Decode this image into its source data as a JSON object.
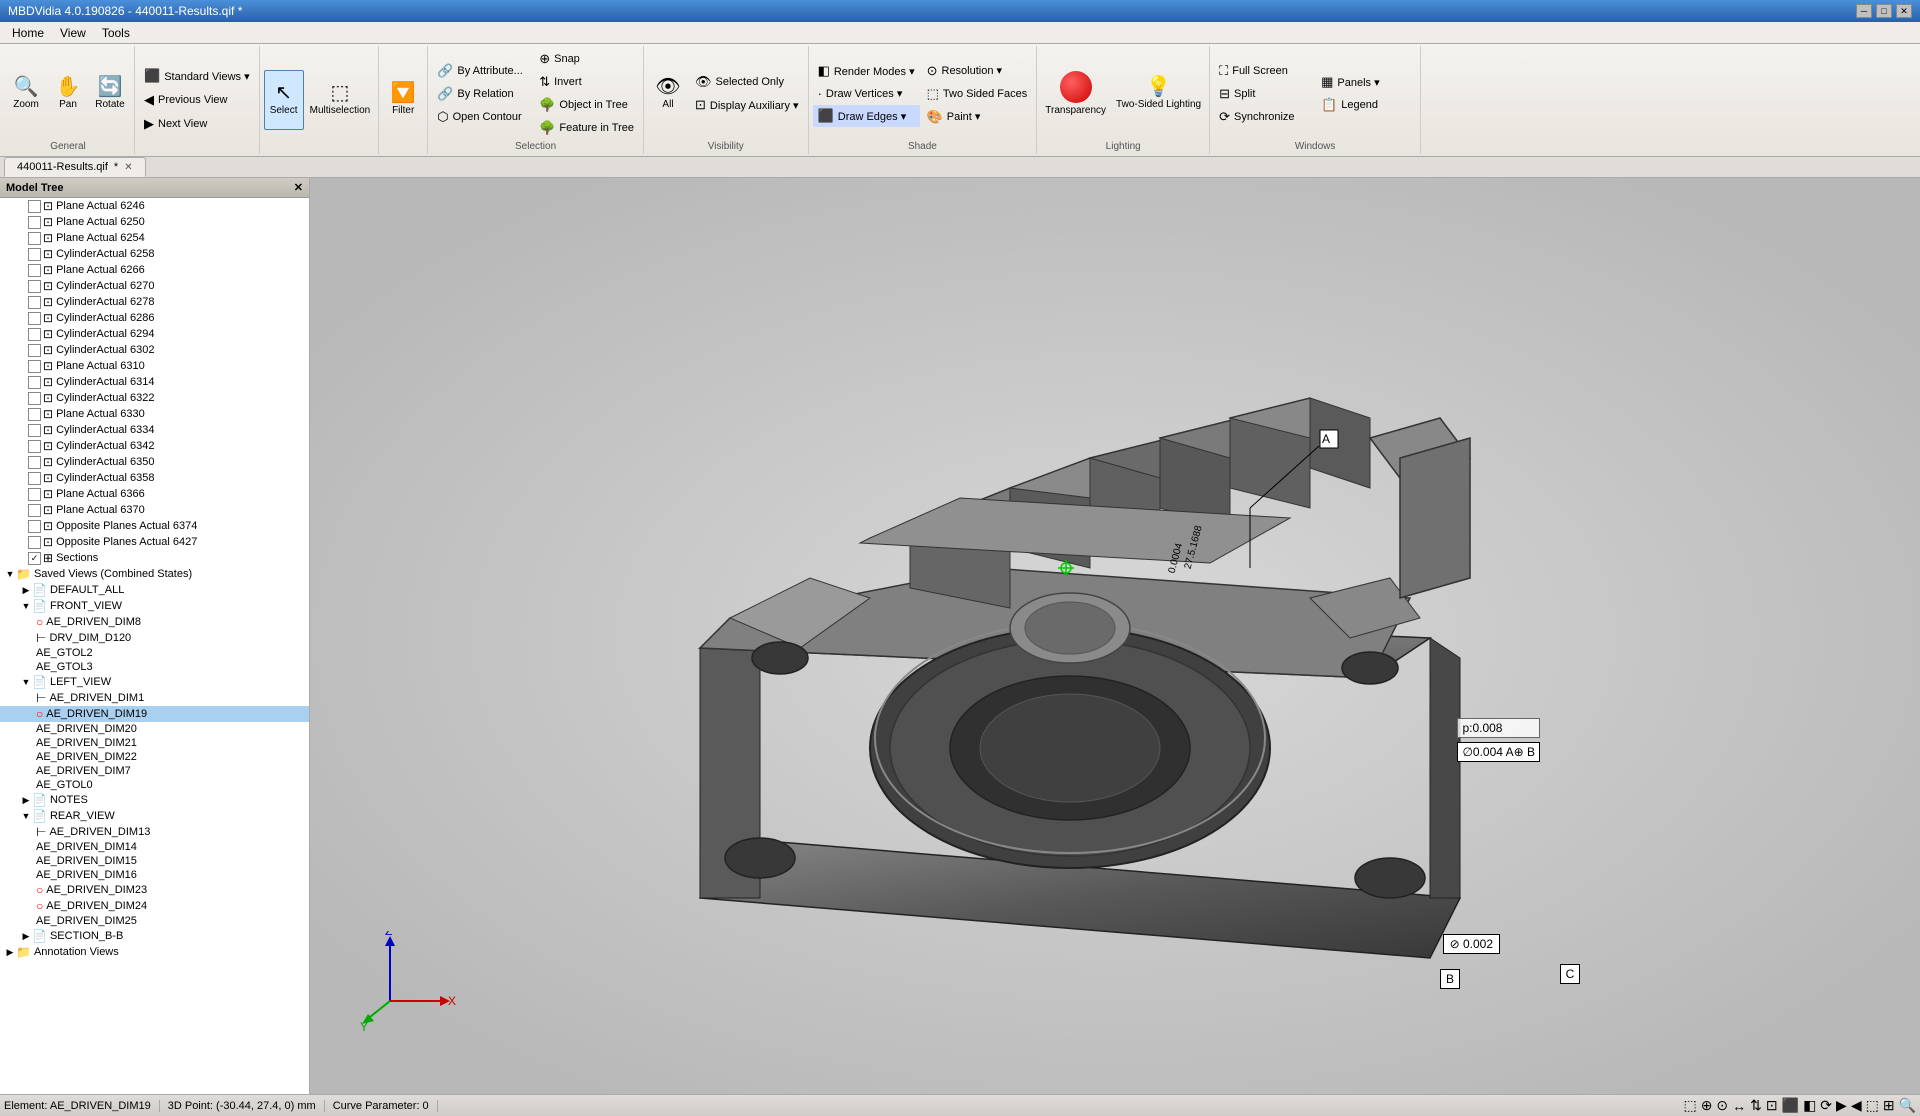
{
  "titleBar": {
    "title": "MBDVidia 4.0.190826 - 440011-Results.qif *",
    "minimize": "─",
    "restore": "□",
    "close": "✕"
  },
  "menuBar": {
    "items": [
      "Home",
      "View",
      "Tools"
    ]
  },
  "toolbar": {
    "general": {
      "label": "General",
      "zoom_label": "Zoom",
      "pan_label": "Pan",
      "rotate_label": "Rotate"
    },
    "standardViews": {
      "label": "Standard Views ▾",
      "previousView": "Previous View",
      "nextView": "Next View"
    },
    "select": {
      "label": "Select"
    },
    "multiselection": "Multiselection",
    "filter": {
      "label": "Filter"
    },
    "selection": {
      "label": "Selection",
      "byAttribute": "By Attribute...",
      "byRelation": "By Relation",
      "snap": "Snap",
      "openContour": "Open Contour",
      "invert": "Invert",
      "objectInTree": "Object in Tree",
      "featureInTree": "Feature in Tree"
    },
    "visibility": {
      "label": "Visibility",
      "all": "All",
      "selectedOnly": "Selected Only",
      "displayAuxiliary": "Display Auxiliary ▾"
    },
    "shade": {
      "label": "Shade",
      "renderModes": "Render Modes ▾",
      "resolution": "Resolution ▾",
      "drawVertices": "Draw Vertices ▾",
      "twoSidedFaces": "Two Sided Faces",
      "drawEdges": "Draw Edges ▾",
      "paint": "Paint ▾"
    },
    "lighting": {
      "label": "Lighting",
      "transparency": "Transparency",
      "twoSidedLighting": "Two-Sided Lighting"
    },
    "windows": {
      "label": "Windows",
      "fullScreen": "Full Screen",
      "panels": "Panels ▾",
      "split": "Split",
      "legend": "Legend",
      "synchronize": "Synchronize"
    }
  },
  "modelTree": {
    "title": "Model Tree",
    "items": [
      {
        "label": "Plane Actual 6246",
        "indent": 1,
        "type": "plane",
        "checked": false
      },
      {
        "label": "Plane Actual 6250",
        "indent": 1,
        "type": "plane",
        "checked": false
      },
      {
        "label": "Plane Actual 6254",
        "indent": 1,
        "type": "plane",
        "checked": false
      },
      {
        "label": "CylinderActual 6258",
        "indent": 1,
        "type": "cylinder",
        "checked": false
      },
      {
        "label": "Plane Actual 6266",
        "indent": 1,
        "type": "plane",
        "checked": false
      },
      {
        "label": "CylinderActual 6270",
        "indent": 1,
        "type": "cylinder",
        "checked": false
      },
      {
        "label": "CylinderActual 6278",
        "indent": 1,
        "type": "cylinder",
        "checked": false
      },
      {
        "label": "CylinderActual 6286",
        "indent": 1,
        "type": "cylinder",
        "checked": false
      },
      {
        "label": "CylinderActual 6294",
        "indent": 1,
        "type": "cylinder",
        "checked": false
      },
      {
        "label": "CylinderActual 6302",
        "indent": 1,
        "type": "cylinder",
        "checked": false
      },
      {
        "label": "Plane Actual 6310",
        "indent": 1,
        "type": "plane",
        "checked": false
      },
      {
        "label": "CylinderActual 6314",
        "indent": 1,
        "type": "cylinder",
        "checked": false
      },
      {
        "label": "CylinderActual 6322",
        "indent": 1,
        "type": "cylinder",
        "checked": false
      },
      {
        "label": "Plane Actual 6330",
        "indent": 1,
        "type": "plane",
        "checked": false
      },
      {
        "label": "CylinderActual 6334",
        "indent": 1,
        "type": "cylinder",
        "checked": false
      },
      {
        "label": "CylinderActual 6342",
        "indent": 1,
        "type": "cylinder",
        "checked": false
      },
      {
        "label": "CylinderActual 6350",
        "indent": 1,
        "type": "cylinder",
        "checked": false
      },
      {
        "label": "CylinderActual 6358",
        "indent": 1,
        "type": "cylinder",
        "checked": false
      },
      {
        "label": "Plane Actual 6366",
        "indent": 1,
        "type": "plane",
        "checked": false
      },
      {
        "label": "Plane Actual 6370",
        "indent": 1,
        "type": "plane",
        "checked": false
      },
      {
        "label": "Opposite Planes Actual 6374",
        "indent": 1,
        "type": "opposite",
        "checked": false
      },
      {
        "label": "Opposite Planes Actual 6427",
        "indent": 1,
        "type": "opposite",
        "checked": false
      },
      {
        "label": "Sections",
        "indent": 1,
        "type": "sections",
        "checked": true
      },
      {
        "label": "Saved Views (Combined States)",
        "indent": 0,
        "type": "folder",
        "checked": false,
        "expanded": true
      },
      {
        "label": "DEFAULT_ALL",
        "indent": 1,
        "type": "view",
        "checked": false,
        "expanded": false
      },
      {
        "label": "FRONT_VIEW",
        "indent": 1,
        "type": "view",
        "checked": false,
        "expanded": true
      },
      {
        "label": "AE_DRIVEN_DIM8",
        "indent": 2,
        "type": "dim",
        "checked": false
      },
      {
        "label": "DRV_DIM_D120",
        "indent": 2,
        "type": "dim",
        "checked": false
      },
      {
        "label": "AE_GTOL2",
        "indent": 2,
        "type": "gtol",
        "checked": false
      },
      {
        "label": "AE_GTOL3",
        "indent": 2,
        "type": "gtol",
        "checked": false
      },
      {
        "label": "LEFT_VIEW",
        "indent": 1,
        "type": "view",
        "checked": false,
        "expanded": true
      },
      {
        "label": "AE_DRIVEN_DIM1",
        "indent": 2,
        "type": "dim",
        "checked": false
      },
      {
        "label": "AE_DRIVEN_DIM19",
        "indent": 2,
        "type": "dim",
        "checked": false
      },
      {
        "label": "AE_DRIVEN_DIM20",
        "indent": 2,
        "type": "dim",
        "checked": false
      },
      {
        "label": "AE_DRIVEN_DIM21",
        "indent": 2,
        "type": "dim",
        "checked": false
      },
      {
        "label": "AE_DRIVEN_DIM22",
        "indent": 2,
        "type": "dim",
        "checked": false
      },
      {
        "label": "AE_DRIVEN_DIM7",
        "indent": 2,
        "type": "dim",
        "checked": false
      },
      {
        "label": "AE_GTOL0",
        "indent": 2,
        "type": "gtol",
        "checked": false
      },
      {
        "label": "NOTES",
        "indent": 1,
        "type": "notes",
        "checked": false
      },
      {
        "label": "REAR_VIEW",
        "indent": 1,
        "type": "view",
        "checked": false,
        "expanded": true
      },
      {
        "label": "AE_DRIVEN_DIM13",
        "indent": 2,
        "type": "dim",
        "checked": false
      },
      {
        "label": "AE_DRIVEN_DIM14",
        "indent": 2,
        "type": "dim",
        "checked": false
      },
      {
        "label": "AE_DRIVEN_DIM15",
        "indent": 2,
        "type": "dim",
        "checked": false
      },
      {
        "label": "AE_DRIVEN_DIM16",
        "indent": 2,
        "type": "dim",
        "checked": false
      },
      {
        "label": "AE_DRIVEN_DIM23",
        "indent": 2,
        "type": "dim",
        "checked": false
      },
      {
        "label": "AE_DRIVEN_DIM24",
        "indent": 2,
        "type": "dim",
        "checked": false
      },
      {
        "label": "AE_DRIVEN_DIM25",
        "indent": 2,
        "type": "dim",
        "checked": false
      },
      {
        "label": "SECTION_B-B",
        "indent": 1,
        "type": "section",
        "checked": false
      },
      {
        "label": "Annotation Views",
        "indent": 0,
        "type": "folder",
        "checked": false
      }
    ]
  },
  "tab": {
    "label": "440011-Results.qif",
    "modified": true
  },
  "statusBar": {
    "element": "Element: AE_DRIVEN_DIM19",
    "point3d": "3D Point: (-30.44, 27.4, 0) mm",
    "curveParam": "Curve Parameter: 0"
  },
  "viewport": {
    "bgColor": "#c8c8c8",
    "axisX": "X",
    "axisY": "Y",
    "axisZ": "Z"
  },
  "annotations": {
    "dim1": "27.5.1688",
    "dim2": "0.0004",
    "dim3": "p:0.008",
    "dimBox1": "∅0.004  A⊕  B",
    "dimBox2": "⊘ 0.002",
    "labelA": "A",
    "labelB": "B",
    "labelC": "C"
  }
}
